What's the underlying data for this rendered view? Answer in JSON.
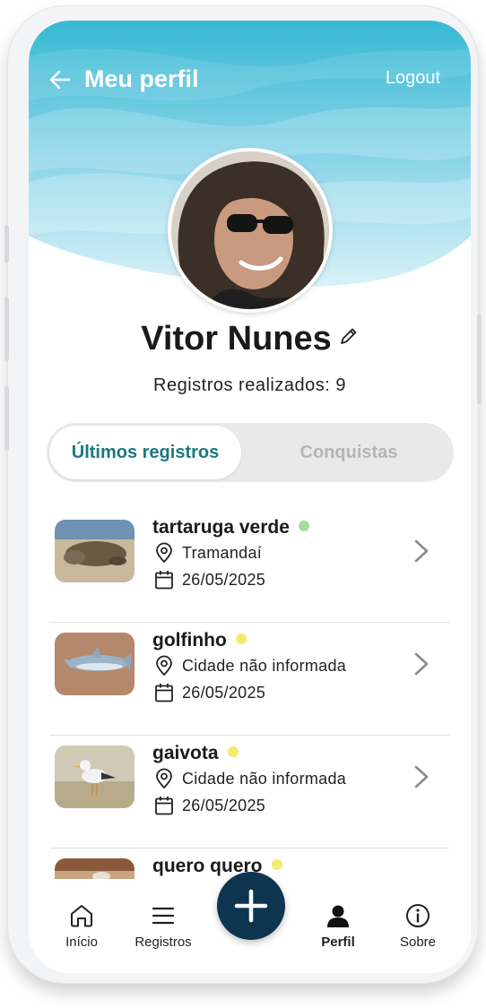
{
  "header": {
    "title": "Meu perfil",
    "back_icon": "arrow-left-icon",
    "logout_label": "Logout"
  },
  "profile": {
    "name": "Vitor Nunes",
    "edit_icon": "pencil-icon",
    "records_text": "Registros realizados: 9"
  },
  "tabs": {
    "active_label": "Últimos registros",
    "inactive_label": "Conquistas"
  },
  "records": [
    {
      "species": "tartaruga verde",
      "status_color": "#a7dca0",
      "location": "Tramandaí",
      "date": "26/05/2025",
      "thumb": "sea-turtle-photo"
    },
    {
      "species": "golfinho",
      "status_color": "#f5ea6e",
      "location": "Cidade não informada",
      "date": "26/05/2025",
      "thumb": "dolphin-photo"
    },
    {
      "species": "gaivota",
      "status_color": "#f5ea6e",
      "location": "Cidade não informada",
      "date": "26/05/2025",
      "thumb": "seagull-photo"
    },
    {
      "species": "quero quero",
      "status_color": "#f5ea6e",
      "location": "",
      "date": "",
      "thumb": "bird-photo"
    }
  ],
  "nav": {
    "items": [
      {
        "label": "Início",
        "icon": "home-icon"
      },
      {
        "label": "Registros",
        "icon": "menu-icon"
      },
      {
        "label": "Perfil",
        "icon": "user-icon",
        "active": true
      },
      {
        "label": "Sobre",
        "icon": "info-icon"
      }
    ],
    "fab_icon": "plus-icon"
  },
  "colors": {
    "header_gradient_top": "#3bbcd6",
    "header_gradient_bottom": "#cdeef6",
    "tab_active_text": "#1b7880",
    "fab": "#0e3550"
  }
}
